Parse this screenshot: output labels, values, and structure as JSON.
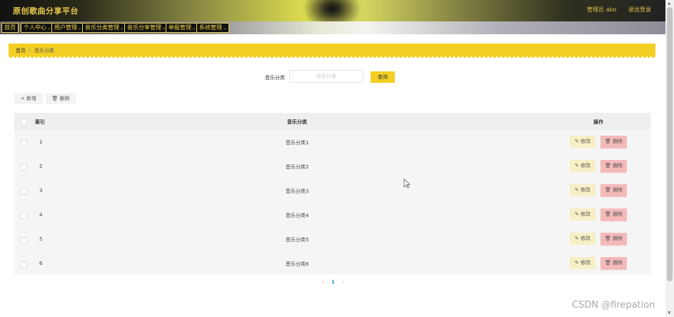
{
  "header": {
    "title": "原创歌曲分享平台",
    "user_greeting": "管理员 abo",
    "logout": "退出登录"
  },
  "nav": {
    "items": [
      {
        "label": "首页",
        "has_caret": false
      },
      {
        "label": "个人中心",
        "has_caret": true
      },
      {
        "label": "用户管理",
        "has_caret": true
      },
      {
        "label": "音乐分类管理",
        "has_caret": true
      },
      {
        "label": "音乐分享管理",
        "has_caret": true
      },
      {
        "label": "举报管理",
        "has_caret": true
      },
      {
        "label": "系统管理",
        "has_caret": true
      }
    ],
    "caret": "⌄"
  },
  "breadcrumb": {
    "home": "首页",
    "separator": "/",
    "current": "音乐分类"
  },
  "search": {
    "label": "音乐分类",
    "placeholder": "音乐分类",
    "button": "查询"
  },
  "toolbar": {
    "add_label": "+ 新增",
    "delete_label": "删除"
  },
  "table": {
    "headers": {
      "index": "索引",
      "category": "音乐分类",
      "actions": "操作"
    },
    "rows": [
      {
        "index": "1",
        "category": "音乐分类1"
      },
      {
        "index": "2",
        "category": "音乐分类2"
      },
      {
        "index": "3",
        "category": "音乐分类3"
      },
      {
        "index": "4",
        "category": "音乐分类4"
      },
      {
        "index": "5",
        "category": "音乐分类5"
      },
      {
        "index": "6",
        "category": "音乐分类6"
      }
    ],
    "edit_label": "修改",
    "delete_label": "删除"
  },
  "pagination": {
    "prev": "‹",
    "current": "1",
    "next": "›"
  },
  "watermark": "CSDN @firepation",
  "colors": {
    "accent": "#f2cf22",
    "nav_text": "#f0d24c",
    "delete": "#f5b9b9",
    "edit": "#f7efc6"
  }
}
